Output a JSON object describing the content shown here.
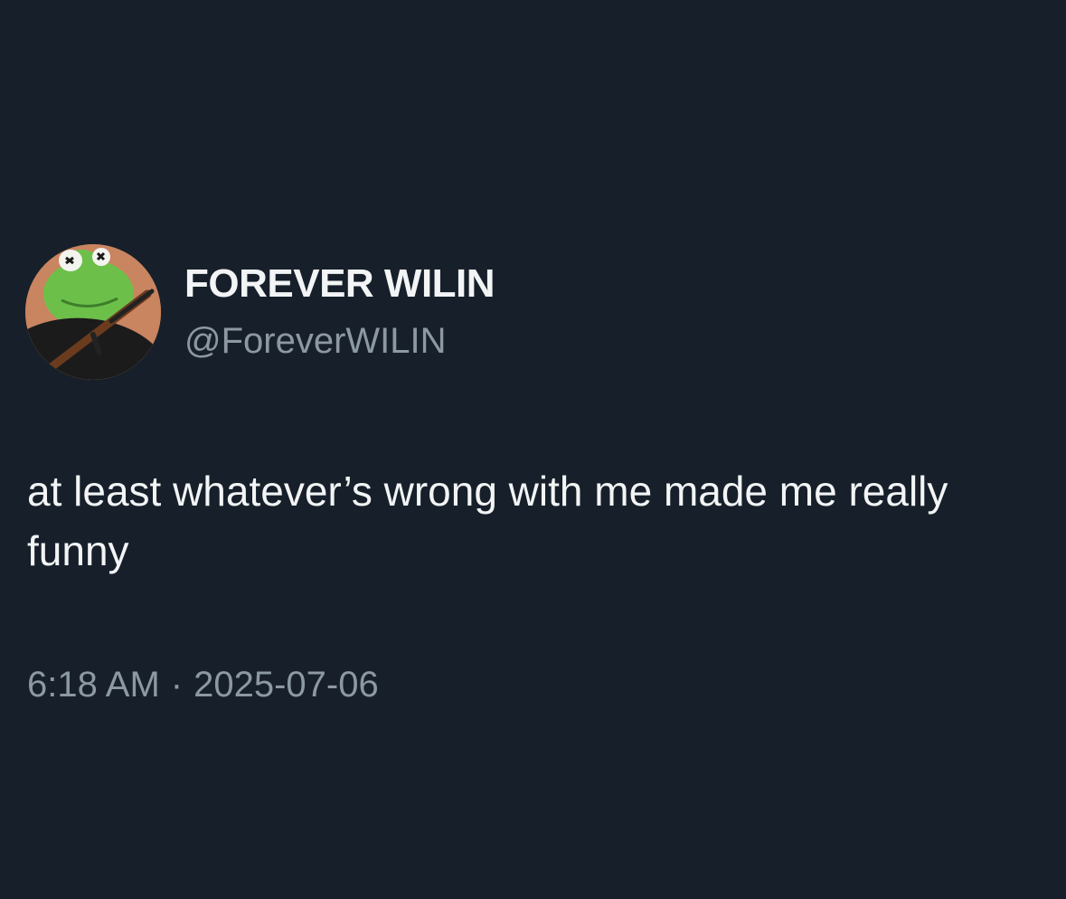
{
  "tweet": {
    "display_name": "FOREVER WILIN",
    "handle": "@ForeverWILIN",
    "text": "at least whatever’s wrong with me made me really funny",
    "time": "6:18 AM",
    "separator": "·",
    "date": "2025-07-06"
  },
  "colors": {
    "background": "#17202a",
    "primary_text": "#f2f4f5",
    "secondary_text": "#8c98a4"
  }
}
